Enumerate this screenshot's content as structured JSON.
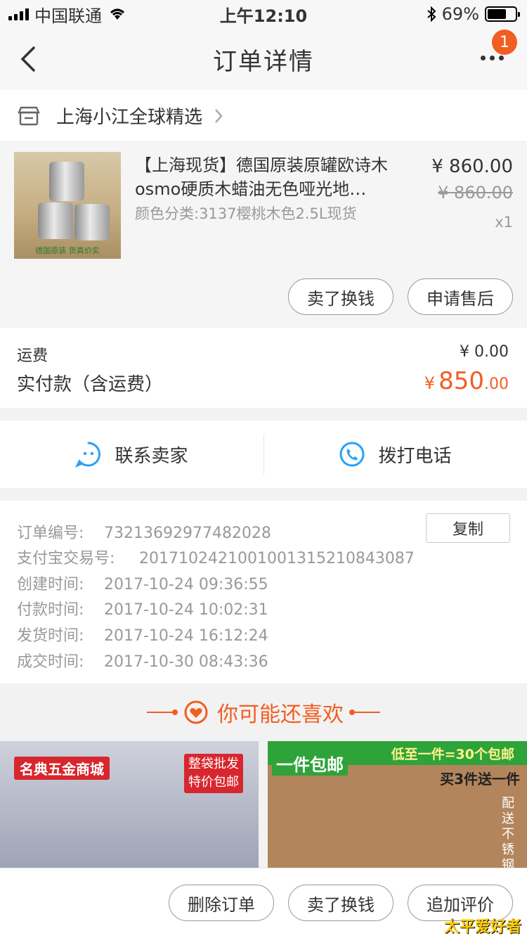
{
  "status_bar": {
    "carrier": "中国联通",
    "time": "上午12:10",
    "battery": "69%",
    "battery_level": 0.69
  },
  "nav": {
    "title": "订单详情",
    "badge": "1"
  },
  "shop": {
    "name": "上海小江全球精选"
  },
  "product": {
    "title": "【上海现货】德国原装原罐欧诗木osmo硬质木蜡油无色哑光地…",
    "sku": "颜色分类:3137樱桃木色2.5L现货",
    "price": "¥ 860.00",
    "original_price": "¥ 860.00",
    "quantity": "x1",
    "image_caption": "德国原装  货真价实",
    "buttons": {
      "sell": "卖了换钱",
      "after_sale": "申请售后"
    }
  },
  "fees": {
    "shipping_label": "运费",
    "shipping_value": "¥ 0.00",
    "paid_label": "实付款（含运费）",
    "paid_currency": "¥",
    "paid_int": "850",
    "paid_dec": ".00"
  },
  "contact": {
    "seller": "联系卖家",
    "phone": "拨打电话"
  },
  "order_info": {
    "copy_label": "复制",
    "rows": [
      {
        "label": "订单编号:",
        "value": "73213692977482028"
      },
      {
        "label": "支付宝交易号:",
        "value": "2017102421001001315210843087"
      },
      {
        "label": "创建时间:",
        "value": "2017-10-24 09:36:55"
      },
      {
        "label": "付款时间:",
        "value": "2017-10-24 10:02:31"
      },
      {
        "label": "发货时间:",
        "value": "2017-10-24 16:12:24"
      },
      {
        "label": "成交时间:",
        "value": "2017-10-30 08:43:36"
      }
    ]
  },
  "recommend": {
    "title": "你可能还喜欢",
    "left": {
      "brand": "名典五金商城",
      "tag1": "整袋批发",
      "tag2": "特价包邮"
    },
    "right": {
      "tag_left": "一件包邮",
      "tag_top": "低至一件=30个包邮",
      "sub": "买3件送一件",
      "side": "配送不锈钢"
    }
  },
  "bottom": {
    "delete": "删除订单",
    "sell": "卖了换钱",
    "review": "追加评价",
    "watermark": "太平爱好者"
  },
  "colors": {
    "accent": "#f25d22",
    "contact_icon": "#29a1f7"
  }
}
